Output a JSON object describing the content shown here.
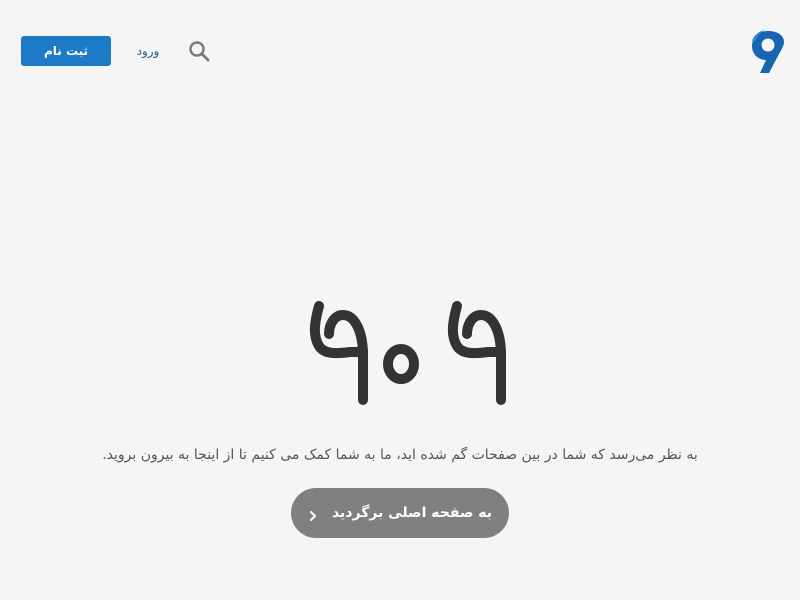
{
  "header": {
    "signup_label": "ثبت نام",
    "login_label": "ورود",
    "search_icon": "search-icon",
    "logo_icon": "brand-logo-icon"
  },
  "main": {
    "error_code": "۴۰۴",
    "message": "به نظر می‌رسد که شما در بین صفحات گم شده اید، ما به شما کمک می کنیم تا از اینجا به بیرون بروید.",
    "home_button_label": "به صفحه اصلی برگردید",
    "home_button_icon": "chevron-right-icon"
  },
  "colors": {
    "background": "#f5f5f5",
    "primary": "#1d7ac7",
    "login_text": "#1d5d8f",
    "heading": "#333333",
    "body_text": "#555555",
    "home_button": "#808080"
  }
}
